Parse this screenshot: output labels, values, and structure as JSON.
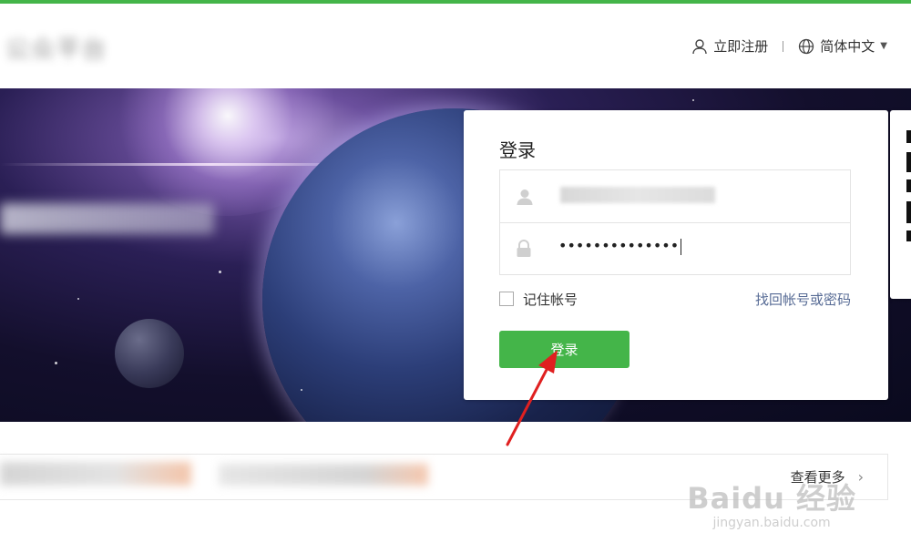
{
  "header": {
    "title": "公众平台",
    "register_label": "立即注册",
    "language_label": "简体中文"
  },
  "login": {
    "title": "登录",
    "password_value": "••••••••••••••",
    "remember_label": "记住帐号",
    "forgot_label": "找回帐号或密码",
    "submit_label": "登录"
  },
  "news": {
    "view_more_label": "查看更多"
  },
  "watermark": {
    "logo": "Baidu 经验",
    "url": "jingyan.baidu.com"
  },
  "colors": {
    "accent": "#44b549",
    "link": "#576b95",
    "annotation_arrow": "#e02020"
  },
  "icons": [
    "user-icon",
    "globe-icon",
    "chevron-down-icon",
    "lock-icon",
    "chevron-right-icon",
    "qr-code-icon"
  ]
}
